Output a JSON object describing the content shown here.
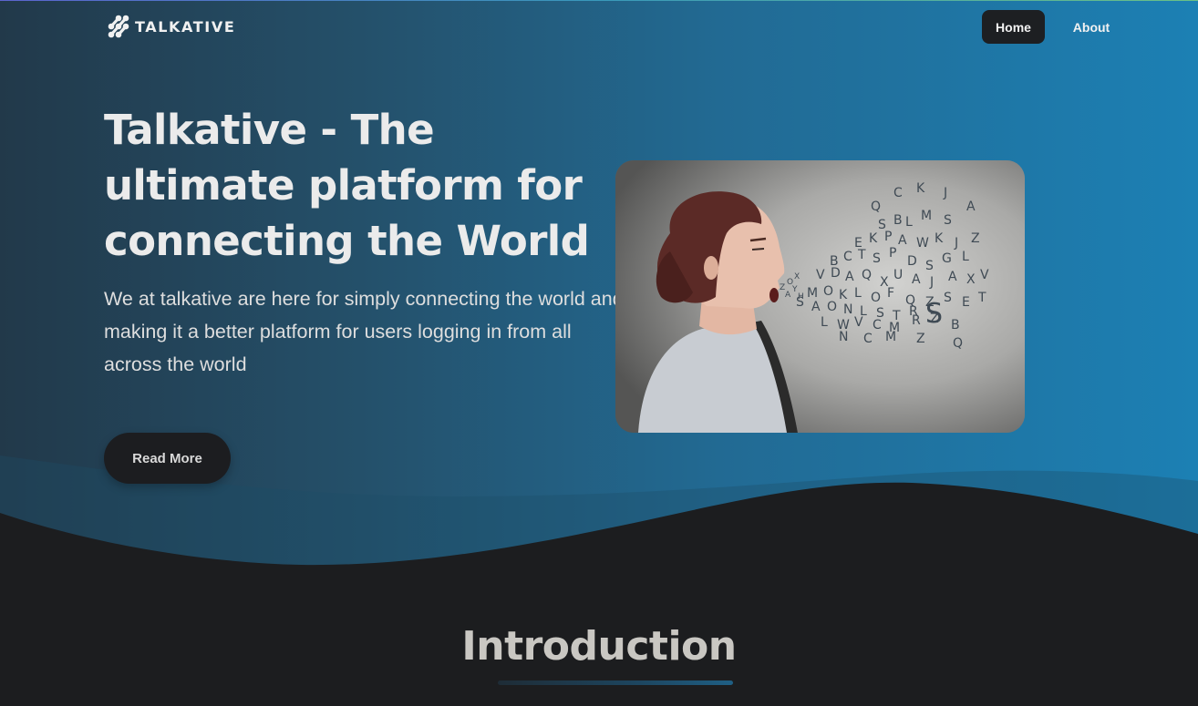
{
  "navbar": {
    "brand": "TALKATIVE",
    "brand_icon": "dots-logo-icon",
    "links": [
      {
        "label": "Home",
        "active": true
      },
      {
        "label": "About",
        "active": false
      }
    ]
  },
  "hero": {
    "title": "Talkative - The ultimate platform for connecting the World",
    "description": "We at talkative are here for simply connecting the world and making it a better platform for users logging in from all across the world",
    "cta_label": "Read More"
  },
  "intro": {
    "title": "Introduction"
  },
  "colors": {
    "gradient_start": "#22394a",
    "gradient_end": "#1c80b4",
    "dark_bg": "#1c1d1f",
    "button_bg": "#1d1f22",
    "text_light": "#ebebeb"
  }
}
